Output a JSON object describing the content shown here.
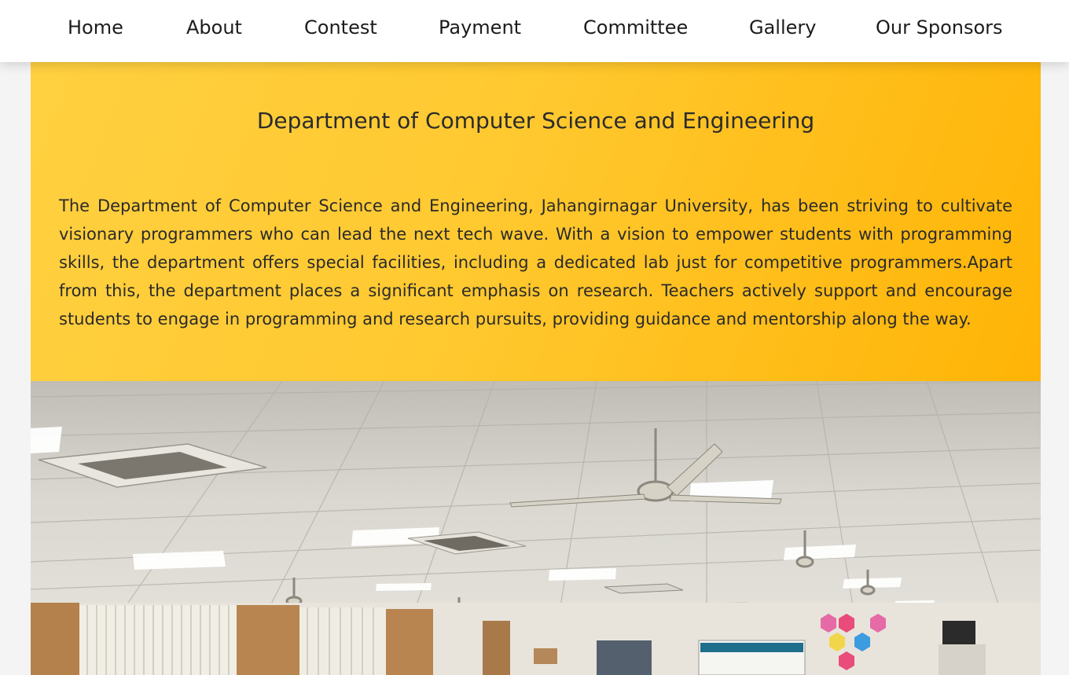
{
  "nav": {
    "items": [
      {
        "label": "Home"
      },
      {
        "label": "About"
      },
      {
        "label": "Contest"
      },
      {
        "label": "Payment"
      },
      {
        "label": "Committee"
      },
      {
        "label": "Gallery"
      },
      {
        "label": "Our Sponsors"
      }
    ]
  },
  "department": {
    "title": "Department of Computer Science and Engineering",
    "description": "The Department of Computer Science and Engineering, Jahangirnagar University, has been striving to cultivate visionary programmers who can lead the next tech wave. With a vision to empower students with programming skills, the department offers special facilities, including a dedicated lab just for competitive programmers.Apart from this, the department places a significant emphasis on research. Teachers actively support and encourage students to engage in programming and research pursuits, providing guidance and mentorship along the way."
  },
  "colors": {
    "panel_gradient_start": "#ffd040",
    "panel_gradient_end": "#ffb406",
    "nav_background": "#ffffff",
    "text": "#2a2a2a"
  }
}
